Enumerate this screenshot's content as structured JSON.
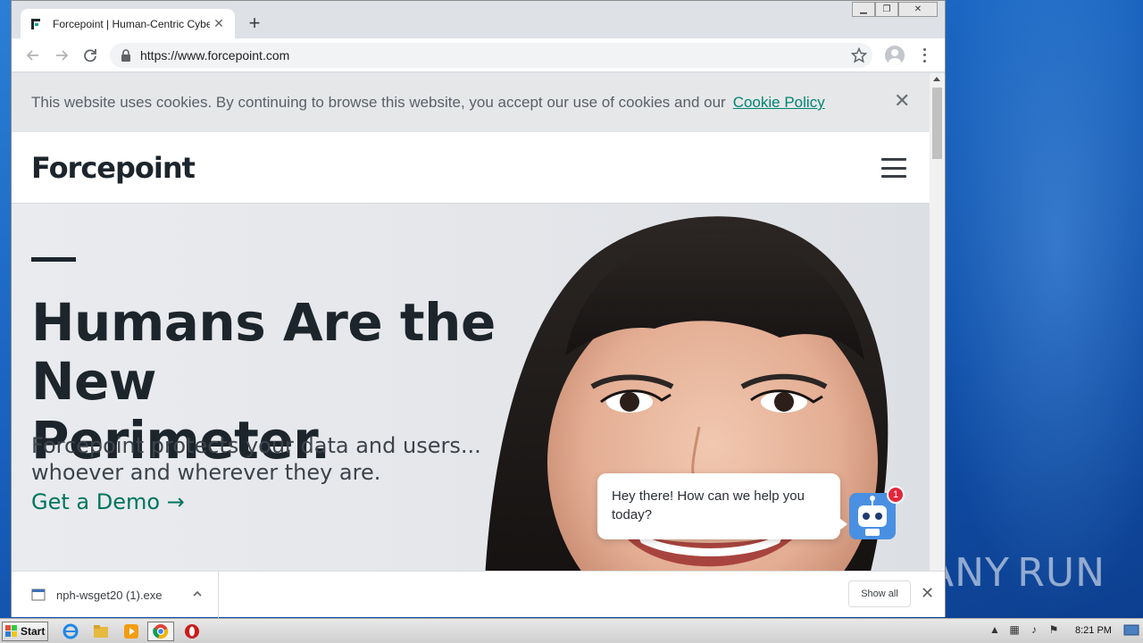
{
  "browser": {
    "tab_title": "Forcepoint | Human-Centric Cybersecurity",
    "url": "https://www.forcepoint.com"
  },
  "page": {
    "cookie_text": "This website uses cookies. By continuing to browse this website, you accept our use of cookies and our",
    "cookie_link": "Cookie Policy",
    "logo_text": "Forcepoint",
    "headline_line1": "Humans Are the New",
    "headline_line2": "Perimeter.",
    "subtitle_line1": "Forcepoint protects your data and users...",
    "subtitle_line2": "whoever and wherever they are.",
    "cta": "Get a Demo →",
    "brand_color": "#00755f"
  },
  "chat": {
    "message": "Hey there! How can we help you today?",
    "badge_count": "1"
  },
  "downloads": {
    "file_name": "nph-wsget20 (1).exe",
    "show_all": "Show all"
  },
  "taskbar": {
    "start_label": "Start",
    "clock": "8:21 PM"
  },
  "watermark": {
    "text": "ANY RUN"
  }
}
